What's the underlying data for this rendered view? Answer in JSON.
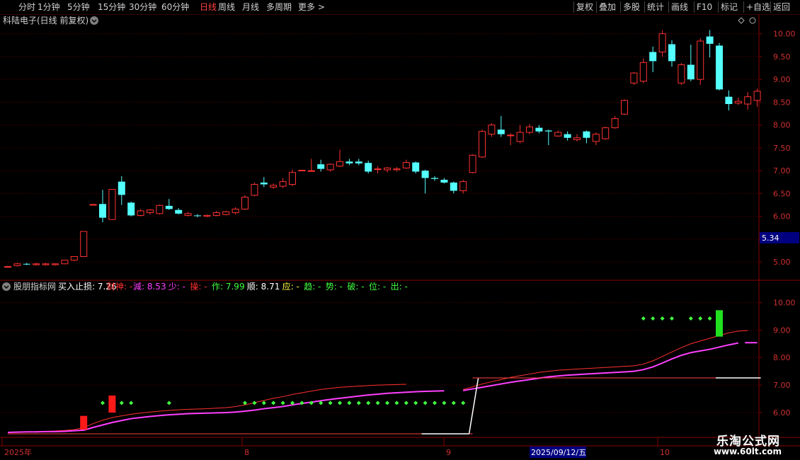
{
  "toolbar": {
    "periods": [
      "分时",
      "1分钟",
      "5分钟",
      "15分钟",
      "30分钟",
      "60分钟",
      "日线",
      "周线",
      "月线",
      "多周期",
      "更多 >"
    ],
    "active": "日线",
    "actions": [
      "复权",
      "叠加",
      "多股",
      "统计",
      "画线",
      "F10",
      "标记",
      "+自选",
      "返回"
    ]
  },
  "main_panel": {
    "title": "科陆电子(日线 前复权)",
    "price_ticks": [
      "10.00",
      "9.50",
      "9.00",
      "8.50",
      "8.00",
      "7.50",
      "7.00",
      "6.50",
      "6.00",
      "5.50",
      "5.00"
    ],
    "current_price_label": "5.34"
  },
  "indicator_panel": {
    "name": "股朋指标网",
    "label_items": [
      {
        "text": "买入止损: 7.26",
        "color": "#ffffff"
      },
      {
        "text": "财神: -",
        "color": "#ff3030"
      },
      {
        "text": "減: 8.53",
        "color": "#ff40ff"
      },
      {
        "text": "少: -",
        "color": "#ff40ff"
      },
      {
        "text": "操: -",
        "color": "#ff3030"
      },
      {
        "text": "作: 7.99",
        "color": "#40ff40"
      },
      {
        "text": "顺: 8.71",
        "color": "#ffffff"
      },
      {
        "text": "应: -",
        "color": "#ffff40"
      },
      {
        "text": "趋: -",
        "color": "#40ff40"
      },
      {
        "text": "势: -",
        "color": "#40ff40"
      },
      {
        "text": "破: -",
        "color": "#40ff40"
      },
      {
        "text": "位: -",
        "color": "#40ff40"
      },
      {
        "text": "出: -",
        "color": "#40ff40"
      }
    ],
    "ticks": [
      "10.00",
      "9.00",
      "8.00",
      "7.00",
      "6.00"
    ]
  },
  "date_axis": {
    "labels": [
      "2025年",
      "8",
      "9",
      "10"
    ],
    "cursor_date": "2025/09/12/五"
  },
  "chart_data": {
    "type": "candlestick",
    "title": "科陆电子(日线 前复权)",
    "ylim": [
      4.6,
      10.15
    ],
    "indicator_ylim": [
      5.1,
      10.5
    ],
    "candles": [
      {
        "o": 4.9,
        "h": 4.92,
        "l": 4.88,
        "c": 4.9
      },
      {
        "o": 4.92,
        "h": 4.98,
        "l": 4.9,
        "c": 4.96
      },
      {
        "o": 4.96,
        "h": 4.98,
        "l": 4.93,
        "c": 4.95
      },
      {
        "o": 4.94,
        "h": 4.98,
        "l": 4.92,
        "c": 4.96
      },
      {
        "o": 4.94,
        "h": 4.98,
        "l": 4.92,
        "c": 4.96
      },
      {
        "o": 4.94,
        "h": 4.97,
        "l": 4.92,
        "c": 4.96
      },
      {
        "o": 4.96,
        "h": 5.04,
        "l": 4.95,
        "c": 5.04
      },
      {
        "o": 5.04,
        "h": 5.12,
        "l": 5.02,
        "c": 5.12
      },
      {
        "o": 5.12,
        "h": 5.67,
        "l": 5.12,
        "c": 5.67
      },
      {
        "o": 6.26,
        "h": 6.27,
        "l": 6.25,
        "c": 6.26
      },
      {
        "o": 6.27,
        "h": 6.58,
        "l": 5.87,
        "c": 5.97
      },
      {
        "o": 5.93,
        "h": 6.6,
        "l": 5.93,
        "c": 6.59
      },
      {
        "o": 6.76,
        "h": 6.88,
        "l": 6.25,
        "c": 6.47
      },
      {
        "o": 6.3,
        "h": 6.32,
        "l": 6.0,
        "c": 6.02
      },
      {
        "o": 6.02,
        "h": 6.16,
        "l": 6.0,
        "c": 6.12
      },
      {
        "o": 6.08,
        "h": 6.16,
        "l": 6.04,
        "c": 6.14
      },
      {
        "o": 6.06,
        "h": 6.26,
        "l": 6.04,
        "c": 6.24
      },
      {
        "o": 6.23,
        "h": 6.38,
        "l": 6.14,
        "c": 6.16
      },
      {
        "o": 6.14,
        "h": 6.18,
        "l": 6.04,
        "c": 6.06
      },
      {
        "o": 6.02,
        "h": 6.1,
        "l": 6.0,
        "c": 6.06
      },
      {
        "o": 6.02,
        "h": 6.05,
        "l": 5.98,
        "c": 6.01
      },
      {
        "o": 6.0,
        "h": 6.04,
        "l": 5.98,
        "c": 6.02
      },
      {
        "o": 6.02,
        "h": 6.12,
        "l": 6.0,
        "c": 6.08
      },
      {
        "o": 6.04,
        "h": 6.12,
        "l": 6.02,
        "c": 6.1
      },
      {
        "o": 6.08,
        "h": 6.2,
        "l": 6.04,
        "c": 6.16
      },
      {
        "o": 6.16,
        "h": 6.46,
        "l": 6.14,
        "c": 6.42
      },
      {
        "o": 6.46,
        "h": 6.74,
        "l": 6.44,
        "c": 6.7
      },
      {
        "o": 6.74,
        "h": 6.86,
        "l": 6.64,
        "c": 6.7
      },
      {
        "o": 6.64,
        "h": 6.72,
        "l": 6.6,
        "c": 6.68
      },
      {
        "o": 6.66,
        "h": 6.84,
        "l": 6.62,
        "c": 6.76
      },
      {
        "o": 6.7,
        "h": 7.02,
        "l": 6.66,
        "c": 6.96
      },
      {
        "o": 7.01,
        "h": 7.02,
        "l": 6.99,
        "c": 7.01
      },
      {
        "o": 7.0,
        "h": 7.26,
        "l": 6.98,
        "c": 7.0
      },
      {
        "o": 7.14,
        "h": 7.24,
        "l": 6.98,
        "c": 7.04
      },
      {
        "o": 7.02,
        "h": 7.16,
        "l": 6.98,
        "c": 7.14
      },
      {
        "o": 7.1,
        "h": 7.46,
        "l": 7.08,
        "c": 7.2
      },
      {
        "o": 7.2,
        "h": 7.26,
        "l": 7.12,
        "c": 7.16
      },
      {
        "o": 7.2,
        "h": 7.26,
        "l": 7.12,
        "c": 7.16
      },
      {
        "o": 7.17,
        "h": 7.22,
        "l": 6.94,
        "c": 6.98
      },
      {
        "o": 7.04,
        "h": 7.1,
        "l": 6.94,
        "c": 7.04
      },
      {
        "o": 7.02,
        "h": 7.08,
        "l": 6.96,
        "c": 7.06
      },
      {
        "o": 7.02,
        "h": 7.08,
        "l": 6.98,
        "c": 7.04
      },
      {
        "o": 7.06,
        "h": 7.24,
        "l": 7.04,
        "c": 7.18
      },
      {
        "o": 7.18,
        "h": 7.2,
        "l": 6.94,
        "c": 6.98
      },
      {
        "o": 7.0,
        "h": 7.02,
        "l": 6.5,
        "c": 6.84
      },
      {
        "o": 6.84,
        "h": 6.88,
        "l": 6.78,
        "c": 6.82
      },
      {
        "o": 6.8,
        "h": 6.84,
        "l": 6.72,
        "c": 6.74
      },
      {
        "o": 6.74,
        "h": 6.76,
        "l": 6.5,
        "c": 6.56
      },
      {
        "o": 6.56,
        "h": 6.8,
        "l": 6.5,
        "c": 6.76
      },
      {
        "o": 6.96,
        "h": 7.36,
        "l": 6.94,
        "c": 7.34
      },
      {
        "o": 7.3,
        "h": 7.9,
        "l": 7.28,
        "c": 7.86
      },
      {
        "o": 7.8,
        "h": 8.04,
        "l": 7.74,
        "c": 8.0
      },
      {
        "o": 7.9,
        "h": 8.2,
        "l": 7.74,
        "c": 7.8
      },
      {
        "o": 7.78,
        "h": 7.82,
        "l": 7.56,
        "c": 7.78
      },
      {
        "o": 7.64,
        "h": 8.0,
        "l": 7.6,
        "c": 7.84
      },
      {
        "o": 7.84,
        "h": 8.02,
        "l": 7.8,
        "c": 7.96
      },
      {
        "o": 7.94,
        "h": 8.0,
        "l": 7.82,
        "c": 7.86
      },
      {
        "o": 7.88,
        "h": 7.9,
        "l": 7.56,
        "c": 7.86
      },
      {
        "o": 7.76,
        "h": 7.88,
        "l": 7.74,
        "c": 7.84
      },
      {
        "o": 7.8,
        "h": 7.86,
        "l": 7.66,
        "c": 7.72
      },
      {
        "o": 7.68,
        "h": 7.8,
        "l": 7.64,
        "c": 7.72
      },
      {
        "o": 7.86,
        "h": 7.88,
        "l": 7.6,
        "c": 7.72
      },
      {
        "o": 7.64,
        "h": 7.84,
        "l": 7.56,
        "c": 7.8
      },
      {
        "o": 7.7,
        "h": 7.96,
        "l": 7.68,
        "c": 7.94
      },
      {
        "o": 7.94,
        "h": 8.2,
        "l": 7.92,
        "c": 8.14
      },
      {
        "o": 8.24,
        "h": 8.56,
        "l": 8.22,
        "c": 8.54
      },
      {
        "o": 8.92,
        "h": 9.16,
        "l": 8.88,
        "c": 9.14
      },
      {
        "o": 8.96,
        "h": 9.46,
        "l": 8.92,
        "c": 9.37
      },
      {
        "o": 9.6,
        "h": 9.72,
        "l": 9.16,
        "c": 9.4
      },
      {
        "o": 9.6,
        "h": 10.08,
        "l": 9.5,
        "c": 10.0
      },
      {
        "o": 9.77,
        "h": 9.86,
        "l": 9.28,
        "c": 9.4
      },
      {
        "o": 8.92,
        "h": 9.36,
        "l": 8.88,
        "c": 9.32
      },
      {
        "o": 9.32,
        "h": 9.76,
        "l": 8.96,
        "c": 9.0
      },
      {
        "o": 9.0,
        "h": 9.9,
        "l": 8.88,
        "c": 9.84
      },
      {
        "o": 9.94,
        "h": 10.08,
        "l": 9.48,
        "c": 9.78
      },
      {
        "o": 9.74,
        "h": 9.8,
        "l": 8.76,
        "c": 8.78
      },
      {
        "o": 8.62,
        "h": 8.76,
        "l": 8.32,
        "c": 8.46
      },
      {
        "o": 8.48,
        "h": 8.6,
        "l": 8.44,
        "c": 8.52
      },
      {
        "o": 8.46,
        "h": 8.72,
        "l": 8.34,
        "c": 8.62
      },
      {
        "o": 8.54,
        "h": 8.8,
        "l": 8.4,
        "c": 8.74
      }
    ],
    "magenta_line_left": [
      5.28,
      5.29,
      5.3,
      5.3,
      5.31,
      5.31,
      5.32,
      5.34,
      5.36,
      5.46,
      5.55,
      5.64,
      5.71,
      5.78,
      5.82,
      5.86,
      5.89,
      5.92,
      5.94,
      5.96,
      5.97,
      5.98,
      5.99,
      6.0,
      6.02,
      6.05,
      6.09,
      6.14,
      6.18,
      6.22,
      6.28,
      6.33,
      6.38,
      6.43,
      6.48,
      6.52,
      6.56,
      6.6,
      6.64,
      6.67,
      6.7,
      6.72,
      6.74,
      6.76,
      6.77,
      6.78,
      6.79
    ],
    "magenta_line_right": [
      6.8,
      6.86,
      6.92,
      6.98,
      7.04,
      7.1,
      7.15,
      7.2,
      7.25,
      7.3,
      7.33,
      7.36,
      7.38,
      7.4,
      7.42,
      7.44,
      7.46,
      7.48,
      7.5,
      7.56,
      7.66,
      7.8,
      7.95,
      8.08,
      8.18,
      8.24,
      8.3,
      8.38,
      8.46,
      8.53
    ],
    "red_line_left": [
      5.29,
      5.3,
      5.3,
      5.31,
      5.32,
      5.33,
      5.35,
      5.38,
      5.45,
      5.6,
      5.72,
      5.82,
      5.88,
      5.94,
      5.98,
      6.02,
      6.05,
      6.08,
      6.1,
      6.12,
      6.13,
      6.14,
      6.16,
      6.18,
      6.22,
      6.28,
      6.36,
      6.44,
      6.52,
      6.58,
      6.66,
      6.72,
      6.78,
      6.84,
      6.88,
      6.92,
      6.94,
      6.96,
      6.98,
      7.0,
      7.01,
      7.02,
      7.03
    ],
    "red_line_right": [
      6.84,
      6.94,
      7.04,
      7.12,
      7.2,
      7.28,
      7.34,
      7.4,
      7.46,
      7.5,
      7.54,
      7.56,
      7.58,
      7.6,
      7.62,
      7.64,
      7.66,
      7.68,
      7.7,
      7.76,
      7.88,
      8.04,
      8.2,
      8.36,
      8.5,
      8.6,
      8.7,
      8.8,
      8.9,
      8.96,
      8.98
    ],
    "stop_line_left": [
      5.23,
      5.23,
      5.23,
      5.23,
      5.23,
      5.23,
      5.23,
      5.23,
      5.23,
      5.23,
      5.23,
      5.23,
      5.23,
      5.23,
      5.23,
      5.23,
      5.23,
      5.23,
      5.23,
      5.23,
      5.23,
      5.23,
      5.23,
      5.23,
      5.23,
      5.23,
      5.23,
      5.23,
      5.23,
      5.23,
      5.23,
      5.23,
      5.23,
      5.23,
      5.23,
      5.23,
      5.23,
      5.23,
      5.23,
      5.23,
      5.23,
      5.23,
      5.23,
      5.23,
      5.23,
      5.23,
      5.23,
      5.23,
      5.23,
      5.23
    ],
    "stop_line_right": [
      7.26,
      7.26,
      7.26,
      7.26,
      7.26,
      7.26,
      7.26,
      7.26,
      7.26,
      7.26,
      7.26,
      7.26,
      7.26,
      7.26,
      7.26,
      7.26,
      7.26,
      7.26,
      7.26,
      7.26,
      7.26,
      7.26,
      7.26,
      7.26,
      7.26,
      7.26,
      7.26,
      7.26,
      7.26,
      7.26,
      7.26
    ],
    "green_dot_level": 6.35,
    "green_dots_left_idx": [
      10,
      11,
      12,
      13,
      17,
      25,
      26,
      27,
      28,
      29,
      30,
      31,
      32,
      33,
      34,
      35,
      36,
      37,
      38,
      39,
      40,
      41,
      42,
      43,
      44,
      45,
      46,
      47,
      48
    ],
    "green_dots_right_idx": [
      67,
      68,
      69,
      70,
      72,
      73,
      74,
      75
    ],
    "green_dots_right_level": 9.42,
    "red_bars": [
      {
        "i": 8,
        "lo": 5.38,
        "hi": 5.88
      },
      {
        "i": 11,
        "lo": 6.0,
        "hi": 6.62
      }
    ],
    "green_bar": {
      "i": 75,
      "lo": 8.76,
      "hi": 9.72
    }
  }
}
